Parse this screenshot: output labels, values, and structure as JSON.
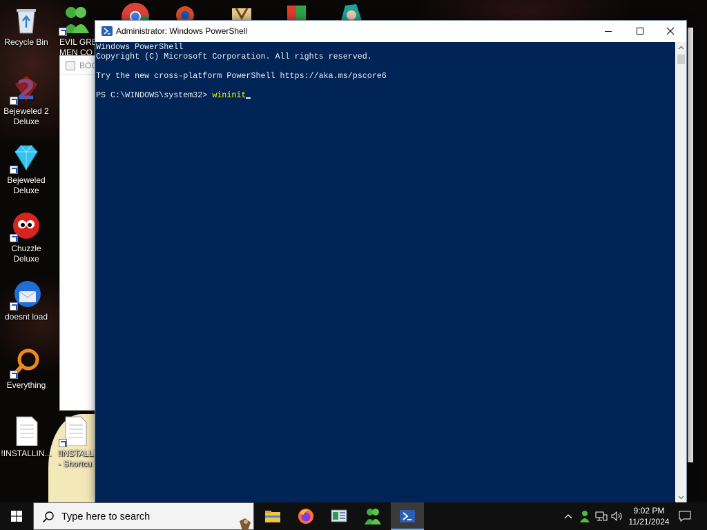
{
  "desktop": {
    "icons": [
      {
        "label": "Recycle Bin",
        "icon": "recycle-bin-icon"
      },
      {
        "label": "Bejeweled 2\nDeluxe",
        "icon": "bejeweled-2-icon"
      },
      {
        "label": "Bejeweled\nDeluxe",
        "icon": "bejeweled-icon"
      },
      {
        "label": "Chuzzle\nDeluxe",
        "icon": "chuzzle-icon"
      },
      {
        "label": "doesnt load",
        "icon": "thunderbird-icon"
      },
      {
        "label": "Everything",
        "icon": "everything-search-icon"
      },
      {
        "label": "!INSTALLIN...",
        "icon": "text-file-icon"
      }
    ],
    "partial_icons": [
      {
        "label": "EVIL GREE\nMEN CO",
        "icon": "green-men-icon"
      },
      {
        "label": "!INSTALLI\n- Shortcu",
        "icon": "text-file-shortcut-icon"
      }
    ],
    "background_window_title": "BOO"
  },
  "powershell": {
    "title": "Administrator: Windows PowerShell",
    "lines": [
      "Windows PowerShell",
      "Copyright (C) Microsoft Corporation. All rights reserved.",
      "",
      "Try the new cross-platform PowerShell https://aka.ms/pscore6",
      ""
    ],
    "prompt": "PS C:\\WINDOWS\\system32> ",
    "command": "wininit",
    "colors": {
      "background": "#012456",
      "text": "#eeedf0",
      "command": "#ffff00"
    }
  },
  "taskbar": {
    "search_placeholder": "Type here to search",
    "apps": [
      "file-explorer-icon",
      "firefox-icon",
      "control-panel-icon",
      "green-men-icon",
      "powershell-icon"
    ],
    "active_app": "powershell-icon",
    "clock": {
      "time": "9:02 PM",
      "date": "11/21/2024"
    }
  }
}
